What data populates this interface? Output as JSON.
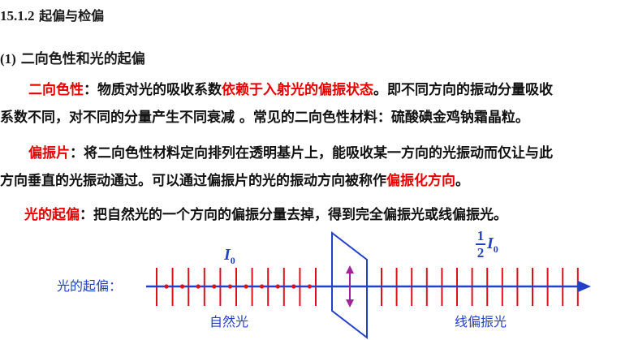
{
  "section": {
    "number": "15.1.2",
    "title": "起偏与检偏"
  },
  "subsection": {
    "number": "(1)",
    "title": "二向色性和光的起偏"
  },
  "para1": {
    "term": "二向色性",
    "colon": "：",
    "text_a": "物质对光的吸收系数",
    "highlight": "依赖于入射光的偏振状态",
    "text_b": "。即不同方向的振动分量吸收",
    "line2": "系数不同，对不同的分量产生不同衰减 。常见的二向色性材料：硫酸碘金鸡钠霜晶粒。"
  },
  "para2": {
    "term": "偏振片",
    "colon": "：",
    "text_a": "将二向色性材料定向排列在透明基片上，能吸收某一方向的光振动而仅让与此",
    "line2_a": "方向垂直的光振动通过。可以通过偏振片的光的振动方向被称作",
    "highlight": "偏振化方向",
    "line2_b": "。"
  },
  "para3": {
    "term": "光的起偏",
    "colon": "：",
    "text": "把自然光的一个方向的偏振分量去掉，得到完全偏振光或线偏振光。"
  },
  "figure": {
    "axis_label": "光的起偏：",
    "natural_label": "自然光",
    "linear_label": "线偏振光",
    "intensity_in": "I",
    "intensity_sub": "0",
    "fraction_num": "1",
    "fraction_den": "2",
    "intensity_out": "I",
    "intensity_out_sub": "0",
    "colors": {
      "line": "#2340c8",
      "tick": "#e0101a",
      "dot": "#e0101a",
      "arrow": "#a0259a"
    }
  }
}
